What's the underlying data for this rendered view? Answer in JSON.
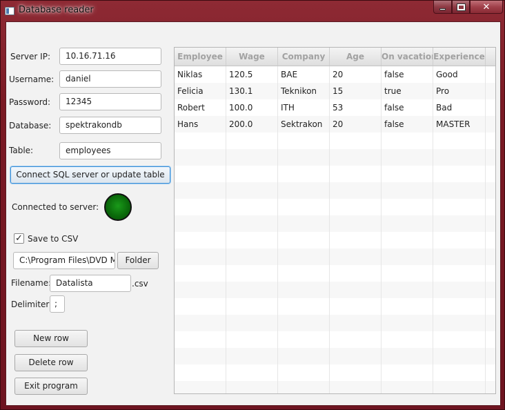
{
  "window": {
    "title": "Database reader",
    "controls": {
      "minimize_icon": "minimize-icon",
      "maximize_icon": "maximize-icon",
      "close_icon": "close-icon",
      "close_glyph": "✕"
    }
  },
  "form": {
    "server_ip": {
      "label": "Server IP:",
      "value": "10.16.71.16"
    },
    "username": {
      "label": "Username:",
      "value": "daniel"
    },
    "password": {
      "label": "Password:",
      "value": "12345"
    },
    "database": {
      "label": "Database:",
      "value": "spektrakondb"
    },
    "table": {
      "label": "Table:",
      "value": "employees"
    },
    "connect_button": "Connect SQL server or update table",
    "connected_label": "Connected to server:",
    "connected_status_color": "#0b6b0b",
    "save_csv": {
      "label": "Save to CSV",
      "checked": true,
      "check_glyph": "✓"
    },
    "folder_path": "C:\\Program Files\\DVD Ma",
    "folder_button": "Folder",
    "filename": {
      "label": "Filename:",
      "value": "Datalista",
      "extension": ".csv"
    },
    "delimiter": {
      "label": "Delimiter:",
      "value": ";"
    },
    "new_row_button": "New row",
    "delete_row_button": "Delete row",
    "exit_button": "Exit program"
  },
  "table": {
    "columns": [
      "Employee",
      "Wage",
      "Company",
      "Age",
      "On vacation",
      "Experience"
    ],
    "rows": [
      [
        "Niklas",
        "120.5",
        "BAE",
        "20",
        "false",
        "Good"
      ],
      [
        "Felicia",
        "130.1",
        "Teknikon",
        "15",
        "true",
        "Pro"
      ],
      [
        "Robert",
        "100.0",
        "ITH",
        "53",
        "false",
        "Bad"
      ],
      [
        "Hans",
        "200.0",
        "Sektrakon",
        "20",
        "false",
        "MASTER"
      ]
    ]
  }
}
